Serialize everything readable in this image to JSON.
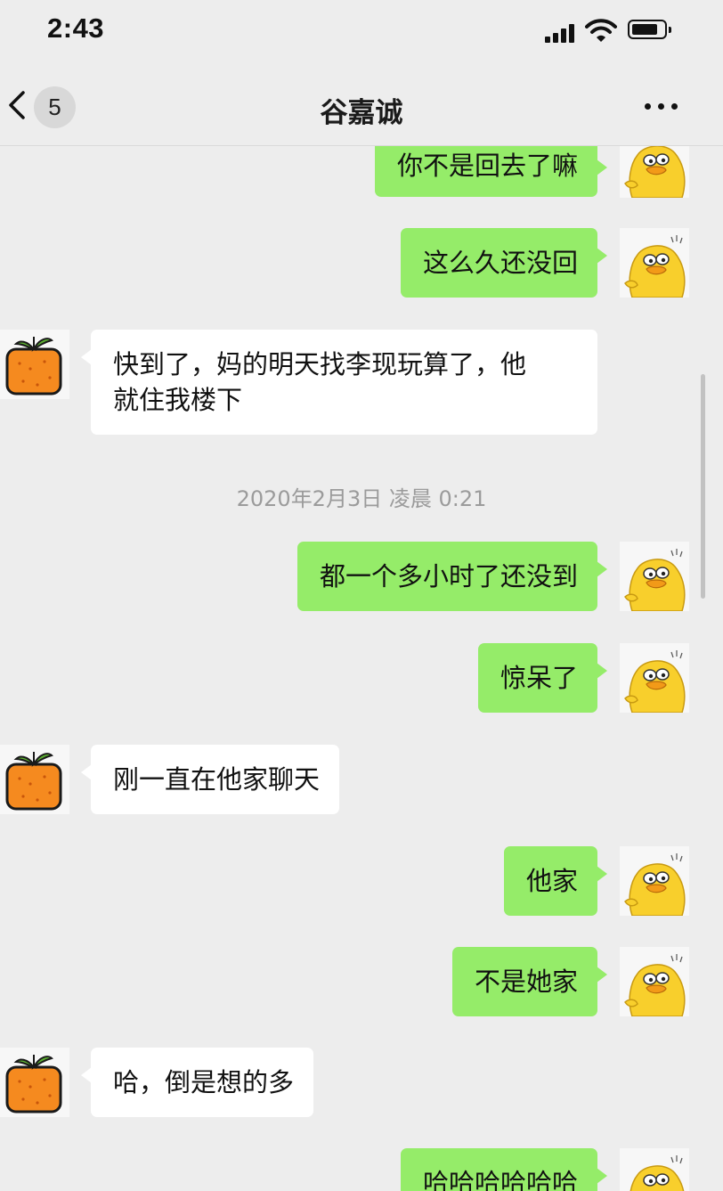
{
  "status_bar": {
    "time": "2:43"
  },
  "header": {
    "unread_count": "5",
    "title": "谷嘉诚"
  },
  "timestamp": "2020年2月3日 凌晨 0:21",
  "messages": [
    {
      "sender": "me",
      "text": "你不是回去了嘛"
    },
    {
      "sender": "me",
      "text": "这么久还没回"
    },
    {
      "sender": "peer",
      "text": "快到了，妈的明天找李现玩算了，他\n就住我楼下"
    },
    {
      "sender": "me",
      "text": "都一个多小时了还没到"
    },
    {
      "sender": "me",
      "text": "惊呆了"
    },
    {
      "sender": "peer",
      "text": "刚一直在他家聊天"
    },
    {
      "sender": "me",
      "text": "他家"
    },
    {
      "sender": "me",
      "text": "不是她家"
    },
    {
      "sender": "peer",
      "text": "哈，倒是想的多"
    },
    {
      "sender": "me",
      "text": "哈哈哈哈哈哈"
    }
  ],
  "avatars": {
    "me": "yellow-duck-icon",
    "peer": "orange-box-icon"
  },
  "colors": {
    "my_bubble": "#95ec69",
    "peer_bubble": "#ffffff",
    "background": "#ededed"
  }
}
